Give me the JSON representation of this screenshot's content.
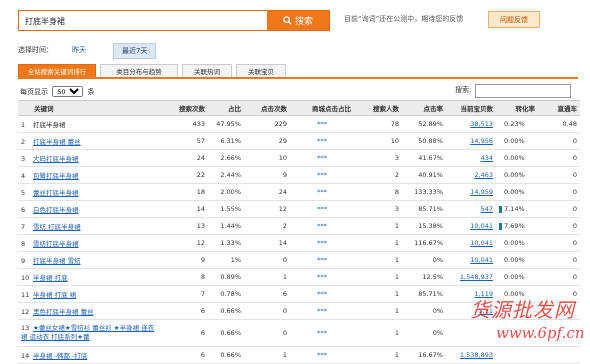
{
  "search": {
    "value": "打底半身裙",
    "button_label": "搜索"
  },
  "notice": "目前“询词”还在公测中，期待您的反馈",
  "feedback_label": "问题反馈",
  "time_select": {
    "label": "选择时间：",
    "options": [
      "昨天",
      "最近7天"
    ],
    "selected": "最近7天"
  },
  "tabs": [
    "全站搜索关键词排行",
    "类目分布与趋势",
    "关联热词",
    "关联宝贝"
  ],
  "page_size": {
    "prefix": "每页显示",
    "value": "50",
    "suffix": "条"
  },
  "filter_label": "搜索:",
  "columns": [
    "关键词",
    "搜索次数",
    "占比",
    "点击次数",
    "商城点击占比",
    "搜索人数",
    "点击率",
    "当前宝贝数",
    "转化率",
    "直通车"
  ],
  "rows": [
    {
      "idx": "1",
      "kw": "打底半身裙",
      "search": "433",
      "ratio": "47.95%",
      "clicks": "229",
      "mall": "***",
      "people": "78",
      "ctr": "52.89%",
      "items": "38,513",
      "conv": "0.23%",
      "ztc": "0.48",
      "bar": 0
    },
    {
      "idx": "2",
      "kw": "打底半身裙 蕾丝",
      "search": "57",
      "ratio": "6.31%",
      "clicks": "29",
      "mall": "***",
      "people": "10",
      "ctr": "50.88%",
      "items": "14,956",
      "conv": "0.00%",
      "ztc": "0",
      "bar": 0
    },
    {
      "idx": "3",
      "kw": "大码打底半身裙",
      "search": "24",
      "ratio": "2.66%",
      "clicks": "10",
      "mall": "***",
      "people": "3",
      "ctr": "41.67%",
      "items": "434",
      "conv": "0.00%",
      "ztc": "0",
      "bar": 0
    },
    {
      "idx": "4",
      "kw": "包臀打底半身裙",
      "search": "22",
      "ratio": "2.44%",
      "clicks": "9",
      "mall": "***",
      "people": "2",
      "ctr": "40.91%",
      "items": "2,463",
      "conv": "0.00%",
      "ztc": "0",
      "bar": 0
    },
    {
      "idx": "5",
      "kw": "蕾丝打底半身裙",
      "search": "18",
      "ratio": "2.00%",
      "clicks": "24",
      "mall": "***",
      "people": "8",
      "ctr": "133.33%",
      "items": "14,959",
      "conv": "0.00%",
      "ztc": "0",
      "bar": 0
    },
    {
      "idx": "6",
      "kw": "白色打底半身裙",
      "search": "14",
      "ratio": "1.55%",
      "clicks": "12",
      "mall": "***",
      "people": "3",
      "ctr": "85.71%",
      "items": "547",
      "conv": "7.14%",
      "ztc": "0",
      "bar": 1
    },
    {
      "idx": "7",
      "kw": "雪纺 打底半身裙",
      "search": "13",
      "ratio": "1.44%",
      "clicks": "2",
      "mall": "***",
      "people": "1",
      "ctr": "15.38%",
      "items": "10,041",
      "conv": "7.69%",
      "ztc": "0",
      "bar": 1
    },
    {
      "idx": "8",
      "kw": "雪纺打底半身裙",
      "search": "12",
      "ratio": "1.33%",
      "clicks": "14",
      "mall": "***",
      "people": "1",
      "ctr": "116.67%",
      "items": "10,041",
      "conv": "0.00%",
      "ztc": "0",
      "bar": 0
    },
    {
      "idx": "9",
      "kw": "打底半身裙 雪纺",
      "search": "9",
      "ratio": "1%",
      "clicks": "0",
      "mall": "***",
      "people": "1",
      "ctr": "0%",
      "items": "10,041",
      "conv": "0.00%",
      "ztc": "0",
      "bar": 0
    },
    {
      "idx": "10",
      "kw": "半身裙 打底",
      "search": "8",
      "ratio": "0.89%",
      "clicks": "1",
      "mall": "***",
      "people": "1",
      "ctr": "12.5%",
      "items": "1,548,937",
      "conv": "0.00%",
      "ztc": "0",
      "bar": 0
    },
    {
      "idx": "11",
      "kw": "半身裙 打底 裙",
      "search": "7",
      "ratio": "0.78%",
      "clicks": "6",
      "mall": "***",
      "people": "1",
      "ctr": "85.71%",
      "items": "1,119",
      "conv": "0.00%",
      "ztc": "0",
      "bar": 0
    },
    {
      "idx": "12",
      "kw": "黑色打底半身裙 蕾丝",
      "search": "6",
      "ratio": "0.66%",
      "clicks": "0",
      "mall": "***",
      "people": "1",
      "ctr": "0%",
      "items": "1,11",
      "conv": "",
      "ztc": "",
      "bar": 0
    },
    {
      "idx": "13",
      "kw": "★蕾丝女裙★雪纺衫 蕾丝衫 ★半身裙 连衣裙 运动衣 打底系列★蕾",
      "search": "6",
      "ratio": "0.66%",
      "clicks": "0",
      "mall": "***",
      "people": "1",
      "ctr": "0%",
      "items": "",
      "conv": "",
      "ztc": "",
      "bar": 0
    },
    {
      "idx": "14",
      "kw": "半身裙 -韩都 -打底",
      "search": "6",
      "ratio": "0.66%",
      "clicks": "1",
      "mall": "***",
      "people": "1",
      "ctr": "16.67%",
      "items": "1,538,893",
      "conv": "",
      "ztc": "",
      "bar": 0
    }
  ],
  "watermark": {
    "line1": "货源批发网",
    "line2": "www.6pf.cn"
  }
}
